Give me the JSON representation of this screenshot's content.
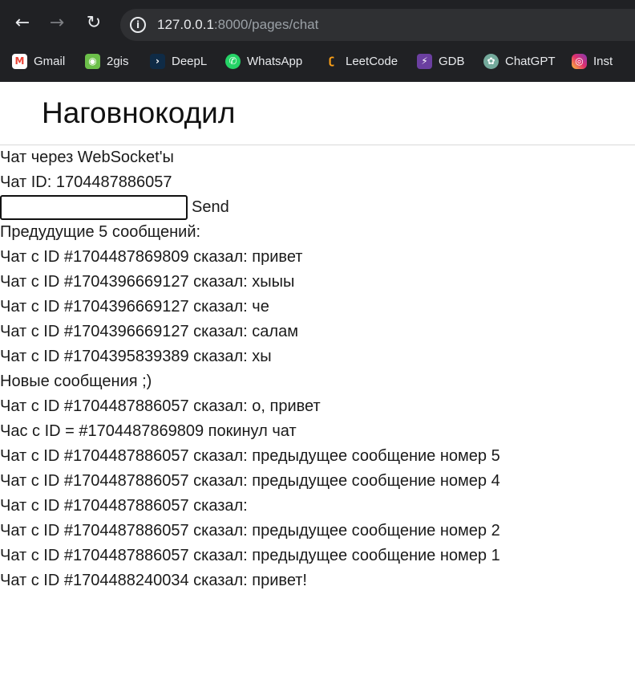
{
  "browser": {
    "url_host": "127.0.0.1",
    "url_rest": ":8000/pages/chat",
    "bookmarks": [
      {
        "label": "Gmail",
        "icon": "gmail-icon",
        "color": "#ea4335",
        "glyph": "M"
      },
      {
        "label": "2gis",
        "icon": "2gis-icon",
        "color": "#6cc04a",
        "glyph": "◉"
      },
      {
        "label": "DeepL",
        "icon": "deepl-icon",
        "color": "#0f2b46",
        "glyph": "›"
      },
      {
        "label": "WhatsApp",
        "icon": "whatsapp-icon",
        "color": "#25d366",
        "glyph": "✆"
      },
      {
        "label": "LeetCode",
        "icon": "leetcode-icon",
        "color": "#202124",
        "glyph": "ʗ"
      },
      {
        "label": "GDB",
        "icon": "gdb-icon",
        "color": "#6b3fa0",
        "glyph": "⚡"
      },
      {
        "label": "ChatGPT",
        "icon": "chatgpt-icon",
        "color": "#74aa9c",
        "glyph": "✿"
      },
      {
        "label": "Inst",
        "icon": "instagram-icon",
        "color": "#d6249f",
        "glyph": "◎"
      }
    ]
  },
  "page": {
    "site_title": "Наговнокодил",
    "subtitle": "Чат через WebSocket'ы",
    "chat_id_line": "Чат ID: 1704487886057",
    "input_value": "",
    "send_label": "Send",
    "previous_heading": "Предудущие 5 сообщений:",
    "previous_messages": [
      "Чат с ID #1704487869809 сказал: привет",
      "Чат с ID #1704396669127 сказал: хыыы",
      "Чат с ID #1704396669127 сказал: че",
      "Чат с ID #1704396669127 сказал: салам",
      "Чат с ID #1704395839389 сказал: хы"
    ],
    "new_heading": "Новые сообщения ;)",
    "new_messages": [
      "Чат с ID #1704487886057 сказал: о, привет",
      "Час с ID = #1704487869809 покинул чат",
      "Чат с ID #1704487886057 сказал: предыдущее сообщение номер 5",
      "Чат с ID #1704487886057 сказал: предыдущее сообщение номер 4",
      "Чат с ID #1704487886057 сказал:",
      "Чат с ID #1704487886057 сказал: предыдущее сообщение номер 2",
      "Чат с ID #1704487886057 сказал: предыдущее сообщение номер 1",
      "Чат с ID #1704488240034 сказал: привет!"
    ]
  }
}
